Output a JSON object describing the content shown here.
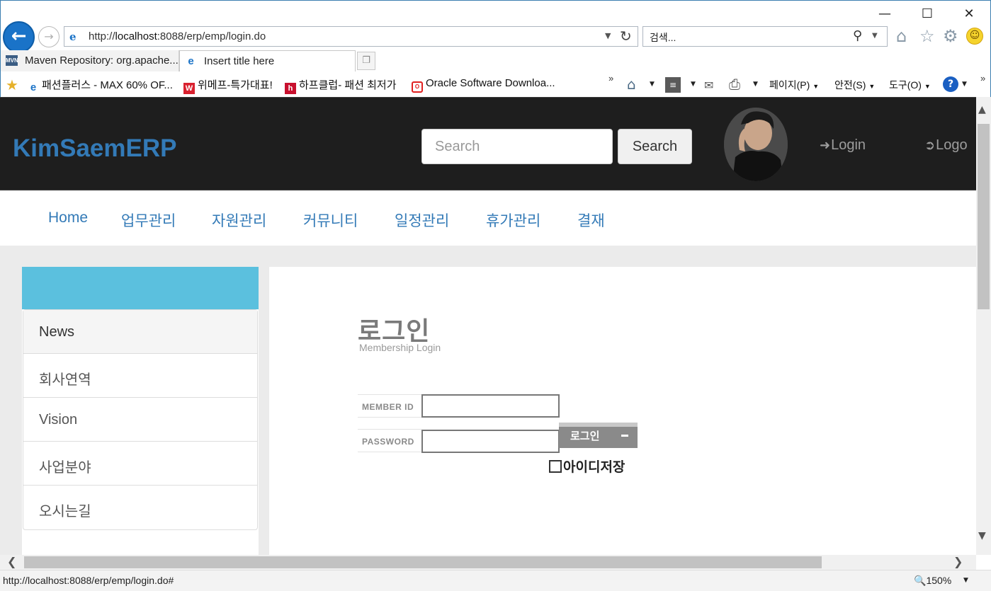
{
  "browser": {
    "address": {
      "prefix": "http://",
      "host": "localhost",
      "rest": ":8088/erp/emp/login.do"
    },
    "search_placeholder": "검색...",
    "tabs": [
      {
        "label": "Maven Repository: org.apache...",
        "icon": "MVN"
      },
      {
        "label": "Insert title here",
        "icon": "e"
      }
    ],
    "favorites": [
      {
        "label": "패션플러스 - MAX 60% OF...",
        "icon": "e"
      },
      {
        "label": "위메프-특가대표!",
        "icon": "W"
      },
      {
        "label": "하프클럽- 패션 최저가",
        "icon": "h"
      },
      {
        "label": "Oracle Software Downloa...",
        "icon": "O"
      }
    ],
    "commands": {
      "page": "페이지(P)",
      "safety": "안전(S)",
      "tools": "도구(O)"
    },
    "status_url": "http://localhost:8088/erp/emp/login.do#",
    "zoom": "150%"
  },
  "site": {
    "brand": "KimSaemERP",
    "search_placeholder": "Search",
    "search_button": "Search",
    "login": "Login",
    "logout": "Logo"
  },
  "nav": [
    "Home",
    "업무관리",
    "자원관리",
    "커뮤니티",
    "일정관리",
    "휴가관리",
    "결재"
  ],
  "sidebar": [
    "News",
    "회사연역",
    "Vision",
    "사업분야",
    "오시는길"
  ],
  "login_form": {
    "title": "로그인",
    "subtitle": "Membership Login",
    "id_label": "MEMBER ID",
    "pw_label": "PASSWORD",
    "button": "로그인",
    "save_id": "아이디저장"
  },
  "colors": {
    "brand": "#337ab7",
    "header_bg": "#1e1e1e",
    "sidebar_header": "#5bc0de"
  }
}
